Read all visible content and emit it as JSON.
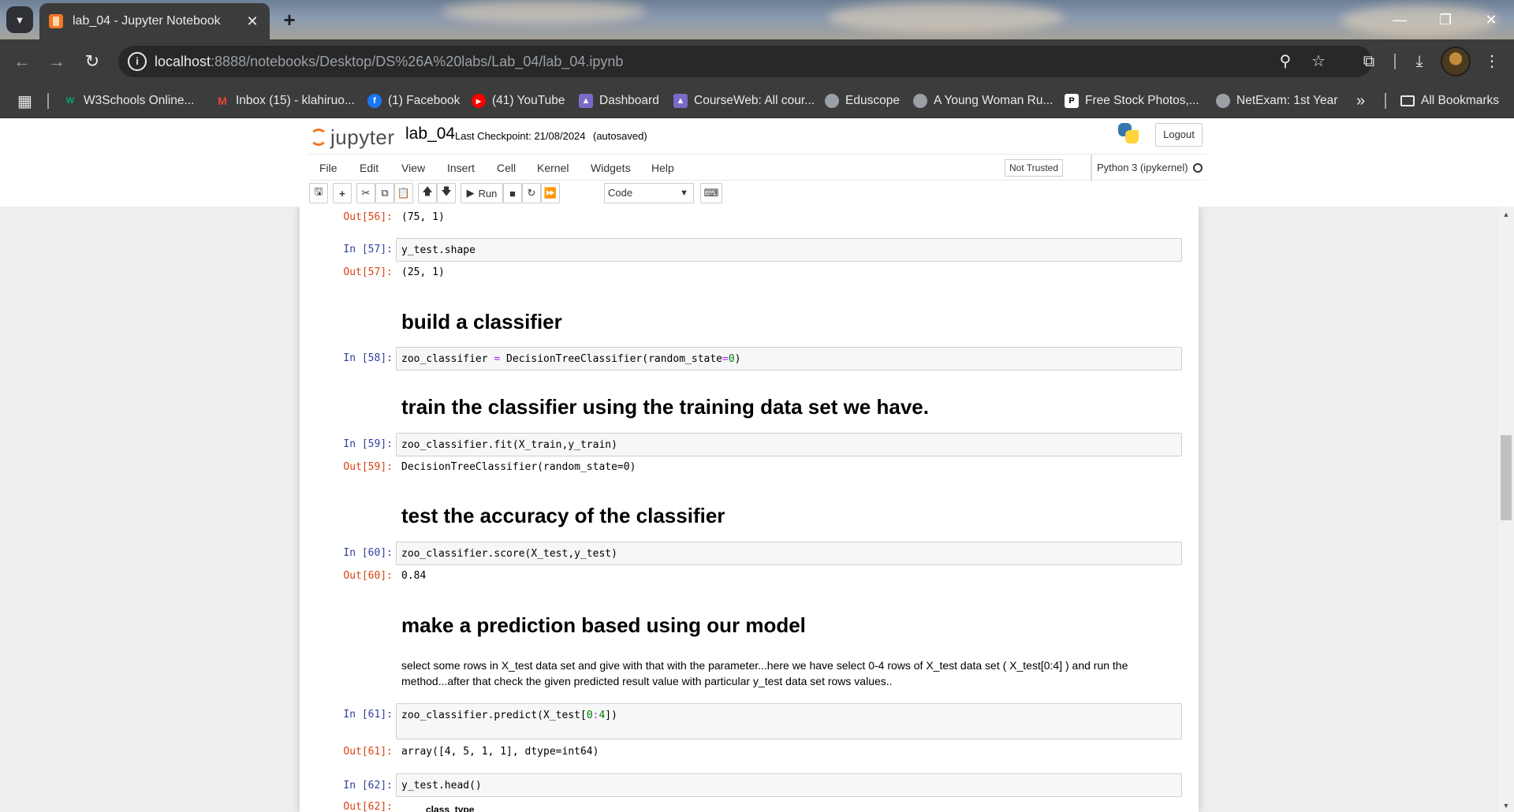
{
  "browser": {
    "tab_title": "lab_04 - Jupyter Notebook",
    "url_host": "localhost",
    "url_path": ":8888/notebooks/Desktop/DS%26A%20labs/Lab_04/lab_04.ipynb",
    "bookmarks": [
      {
        "label": "W3Schools Online...",
        "icon": "w3schools-icon",
        "color": "#04aa6d"
      },
      {
        "label": "Inbox (15) - klahiruo...",
        "icon": "gmail-icon",
        "color": "#ea4335"
      },
      {
        "label": "(1) Facebook",
        "icon": "facebook-icon",
        "color": "#1877f2"
      },
      {
        "label": "(41) YouTube",
        "icon": "youtube-icon",
        "color": "#ff0000"
      },
      {
        "label": "Dashboard",
        "icon": "university-icon",
        "color": "#7a6bc9"
      },
      {
        "label": "CourseWeb: All cour...",
        "icon": "university-icon",
        "color": "#7a6bc9"
      },
      {
        "label": "Eduscope",
        "icon": "globe-icon",
        "color": "#9aa0a6"
      },
      {
        "label": "A Young Woman Ru...",
        "icon": "globe-icon",
        "color": "#9aa0a6"
      },
      {
        "label": "Free Stock Photos,...",
        "icon": "pexels-icon",
        "color": "#05a081"
      },
      {
        "label": "NetExam: 1st Year",
        "icon": "globe-icon",
        "color": "#9aa0a6"
      }
    ],
    "all_bookmarks": "All Bookmarks",
    "overflow": "»"
  },
  "jupyter": {
    "logo_text": "jupyter",
    "notebook_name": "lab_04",
    "checkpoint": "Last Checkpoint: 21/08/2024",
    "autosaved": "(autosaved)",
    "logout": "Logout",
    "menu": [
      "File",
      "Edit",
      "View",
      "Insert",
      "Cell",
      "Kernel",
      "Widgets",
      "Help"
    ],
    "trust": "Not Trusted",
    "kernel": "Python 3 (ipykernel)",
    "run_label": "Run",
    "cell_type": "Code"
  },
  "cells": {
    "out56_prompt": "Out[56]:",
    "out56": "(75, 1)",
    "in57_prompt": "In [57]:",
    "in57": "y_test.shape",
    "out57_prompt": "Out[57]:",
    "out57": "(25, 1)",
    "h_build": "build a classifier",
    "in58_prompt": "In [58]:",
    "in58_a": "zoo_classifier ",
    "in58_op": "=",
    "in58_b": " DecisionTreeClassifier(random_state",
    "in58_op2": "=",
    "in58_num": "0",
    "in58_c": ")",
    "h_train": "train the classifier using the training data set we have.",
    "in59_prompt": "In [59]:",
    "in59": "zoo_classifier.fit(X_train,y_train)",
    "out59_prompt": "Out[59]:",
    "out59": "DecisionTreeClassifier(random_state=0)",
    "h_test": "test the accuracy of the classifier",
    "in60_prompt": "In [60]:",
    "in60": "zoo_classifier.score(X_test,y_test)",
    "out60_prompt": "Out[60]:",
    "out60": "0.84",
    "h_predict": "make a prediction based using our model",
    "p_predict": "select some rows in X_test data set and give with that with the parameter...here we have select 0-4 rows of X_test data set ( X_test[0:4] ) and run the method...after that check the given predicted result value with particular y_test data set rows values..",
    "in61_prompt": "In [61]:",
    "in61_a": "zoo_classifier.predict(X_test[",
    "in61_n1": "0",
    "in61_op": ":",
    "in61_n2": "4",
    "in61_b": "])",
    "out61_prompt": "Out[61]:",
    "out61": "array([4, 5, 1, 1], dtype=int64)",
    "in62_prompt": "In [62]:",
    "in62": "y_test.head()",
    "out62_prompt": "Out[62]:",
    "out62": "class_type"
  }
}
